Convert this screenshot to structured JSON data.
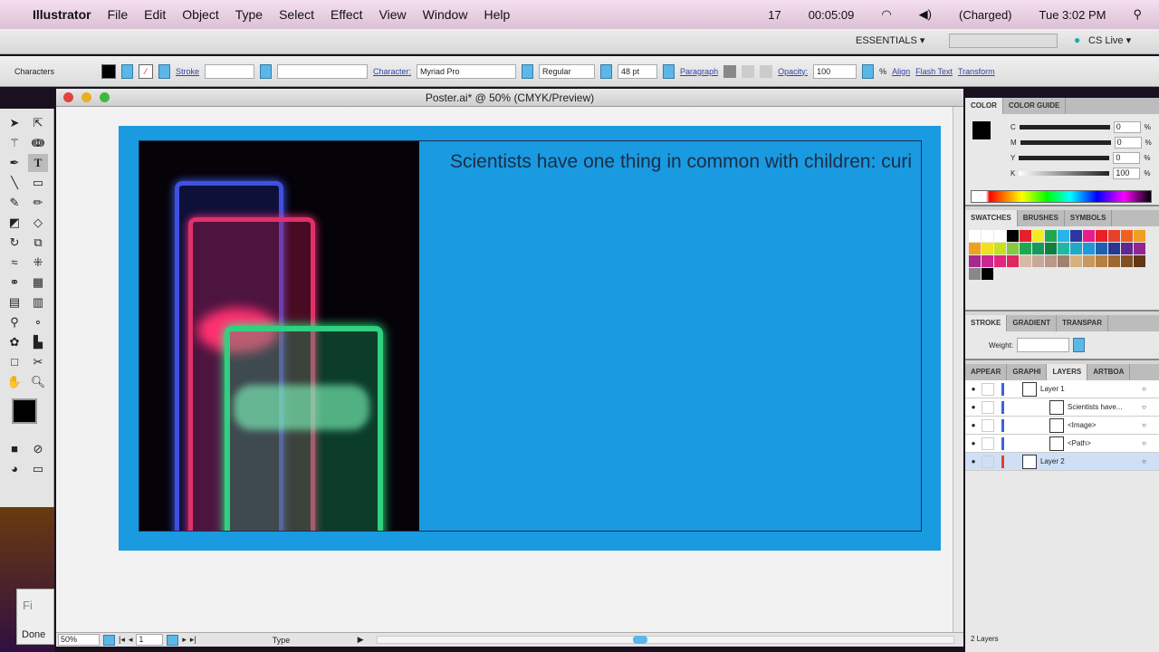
{
  "menubar": {
    "apple": "",
    "app": "Illustrator",
    "items": [
      "File",
      "Edit",
      "Object",
      "Type",
      "Select",
      "Effect",
      "View",
      "Window",
      "Help"
    ],
    "status_num": "17",
    "timer": "00:05:09",
    "battery": "(Charged)",
    "clock": "Tue 3:02 PM"
  },
  "appbar": {
    "workspace": "ESSENTIALS ▾",
    "search_placeholder": "",
    "cslive": "CS Live ▾"
  },
  "control": {
    "mode": "Characters",
    "stroke": "Stroke",
    "character": "Character:",
    "font": "Myriad Pro",
    "style": "Regular",
    "size": "48 pt",
    "paragraph": "Paragraph",
    "opacity_label": "Opacity:",
    "opacity": "100",
    "percent": "%",
    "align": "Align",
    "flash": "Flash Text",
    "transform": "Transform"
  },
  "document": {
    "title": "Poster.ai* @ 50% (CMYK/Preview)",
    "headline": "Scientists have one thing in common with children: curi"
  },
  "status": {
    "zoom": "50%",
    "page": "1",
    "tool": "Type"
  },
  "color_panel": {
    "tabs": [
      "COLOR",
      "COLOR GUIDE"
    ],
    "channels": [
      {
        "label": "C",
        "value": "0"
      },
      {
        "label": "M",
        "value": "0"
      },
      {
        "label": "Y",
        "value": "0"
      },
      {
        "label": "K",
        "value": "100"
      }
    ],
    "unit": "%"
  },
  "swatches_panel": {
    "tabs": [
      "SWATCHES",
      "BRUSHES",
      "SYMBOLS"
    ],
    "colors": [
      "#ffffff",
      "#ffffff",
      "#ffffff",
      "#000000",
      "#e8202a",
      "#f4ea20",
      "#20a850",
      "#28b4e8",
      "#2838a0",
      "#e81c8c",
      "#e8202a",
      "#e8402a",
      "#f06020",
      "#f0a020",
      "#f0a020",
      "#f0e020",
      "#c8e020",
      "#88c840",
      "#20a850",
      "#18985a",
      "#108040",
      "#20b8a0",
      "#20a8c8",
      "#2098d8",
      "#2060b0",
      "#283890",
      "#602890",
      "#902890",
      "#a82890",
      "#c82890",
      "#e02880",
      "#e02860",
      "#d8b8a8",
      "#c8a898",
      "#b89888",
      "#a08070",
      "#d8b080",
      "#c89860",
      "#b88040",
      "#a06830",
      "#805020",
      "#603818",
      "#888888",
      "#000000"
    ]
  },
  "stroke_panel": {
    "tabs": [
      "STROKE",
      "GRADIENT",
      "TRANSPAR"
    ],
    "weight_label": "Weight:"
  },
  "layers_panel": {
    "tabs": [
      "APPEAR",
      "GRAPHI",
      "LAYERS",
      "ARTBOA"
    ],
    "rows": [
      {
        "name": "Layer 1",
        "color": "#4060e0"
      },
      {
        "name": "Scientists have...",
        "color": "#4060e0"
      },
      {
        "name": "<Image>",
        "color": "#4060e0"
      },
      {
        "name": "<Path>",
        "color": "#4060e0"
      },
      {
        "name": "Layer 2",
        "color": "#e04030"
      }
    ],
    "footer": "2 Layers"
  },
  "desktop": {
    "done": "Done",
    "fi": "Fi"
  }
}
